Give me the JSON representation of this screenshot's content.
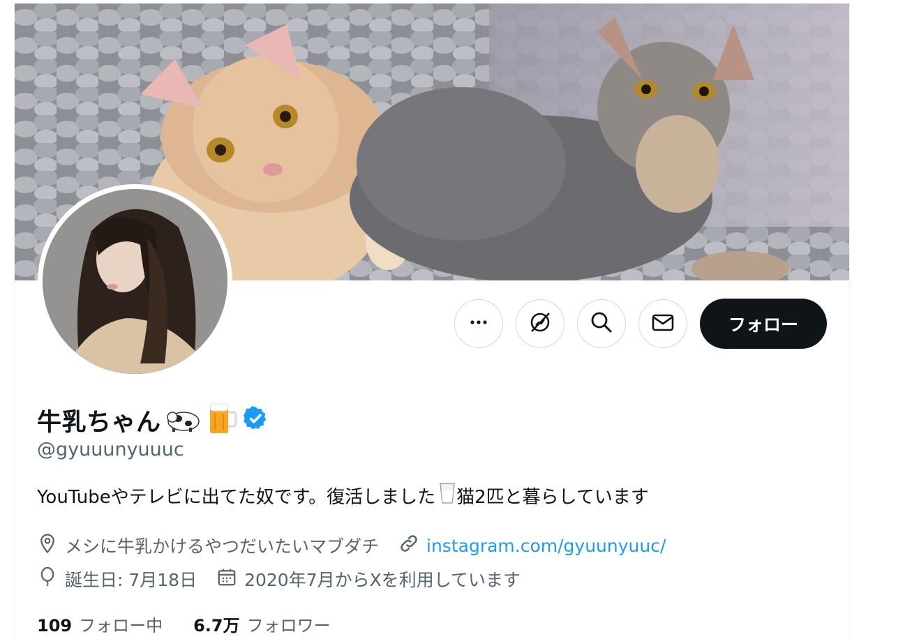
{
  "profile": {
    "display_name": "牛乳ちゃん",
    "handle": "@gyuuunyuuuc",
    "bio_part1": "YouTubeやテレビに出てた奴です。復活しました",
    "bio_part2": " 猫2匹と暮らしています",
    "location": "メシに牛乳かけるやつだいたいマブダチ",
    "website": "instagram.com/gyuunyuuc/",
    "birthday": "誕生日: 7月18日",
    "joined": "2020年7月からXを利用しています"
  },
  "actions": {
    "follow_label": "フォロー"
  },
  "stats": {
    "following_count": "109",
    "following_label": "フォロー中",
    "followers_count": "6.7万",
    "followers_label": "フォロワー"
  },
  "icons": {
    "more": "more-icon",
    "subscribe": "subscribe-icon",
    "search": "search-icon",
    "message": "mail-icon",
    "verified": "verified-badge-icon",
    "location": "location-pin-icon",
    "link": "link-icon",
    "birthday": "balloon-icon",
    "calendar": "calendar-icon"
  },
  "colors": {
    "accent": "#1d9bf0",
    "text_primary": "#0f1419",
    "text_secondary": "#536471",
    "follow_bg": "#0f1419"
  }
}
